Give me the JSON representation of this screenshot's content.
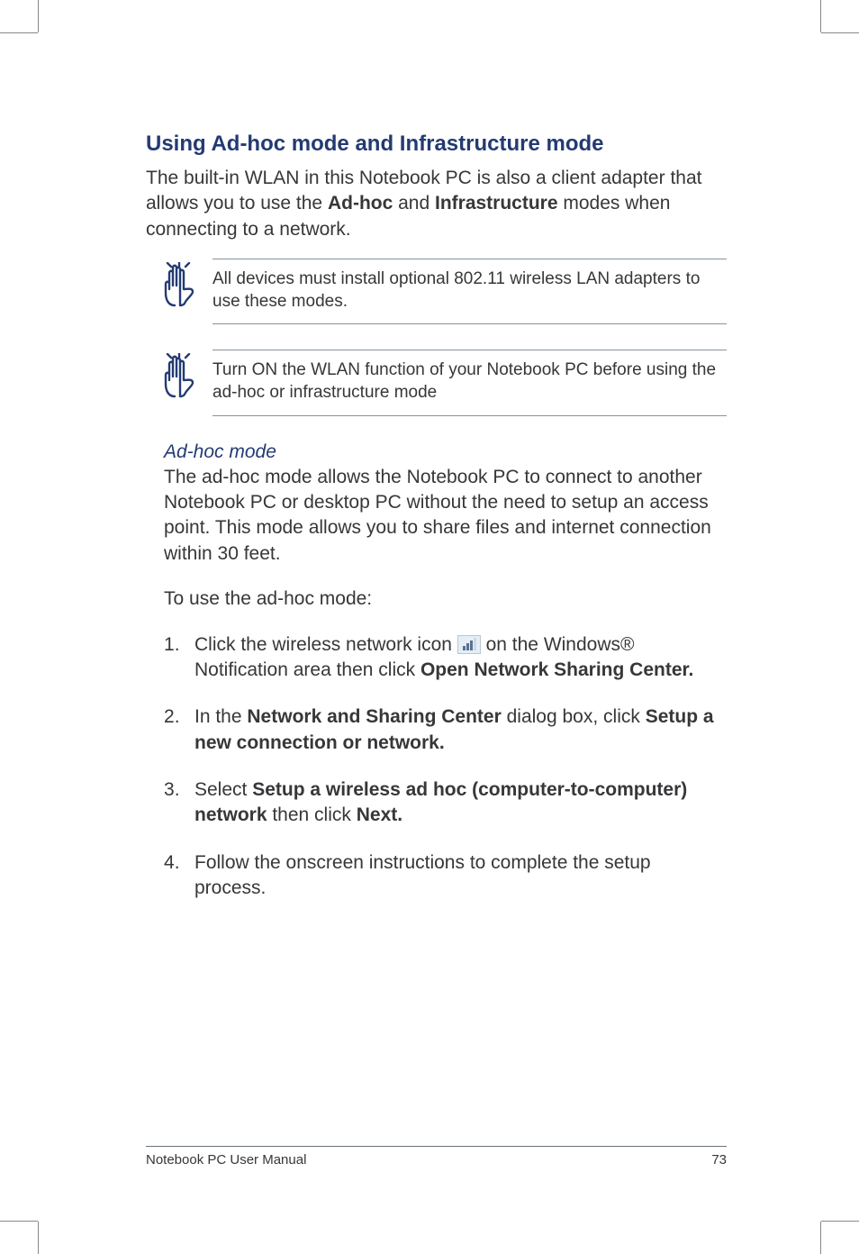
{
  "title": "Using Ad-hoc mode and Infrastructure mode",
  "intro_pre": "The built-in WLAN in this Notebook PC is also a client adapter that allows you to use the ",
  "intro_b1": "Ad-hoc",
  "intro_mid": " and ",
  "intro_b2": "Infrastructure",
  "intro_post": " modes when connecting to a network.",
  "note1": "All devices must install optional 802.11 wireless LAN adapters to use these modes.",
  "note2": "Turn ON the WLAN function of  your Notebook PC before using the ad-hoc or infrastructure mode",
  "adhoc_heading": "Ad-hoc mode",
  "adhoc_body": "The ad-hoc mode allows the Notebook PC to connect to another Notebook PC or desktop PC without the need to setup an access point. This mode allows you to share files and internet connection within 30 feet.",
  "adhoc_use": "To use the ad-hoc mode:",
  "steps": {
    "s1_pre": "Click the wireless network icon ",
    "s1_post": " on the Windows® Notification area then click ",
    "s1_b": "Open Network Sharing Center.",
    "s2_pre": "In the ",
    "s2_b1": "Network and Sharing Center",
    "s2_mid": " dialog box, click ",
    "s2_b2": "Setup a new connection or network.",
    "s3_pre": "Select ",
    "s3_b1": "Setup a wireless ad hoc (computer-to-computer) network",
    "s3_mid": " then click ",
    "s3_b2": "Next.",
    "s4": "Follow the onscreen instructions to complete the setup process."
  },
  "footer_left": "Notebook PC User Manual",
  "footer_right": "73"
}
